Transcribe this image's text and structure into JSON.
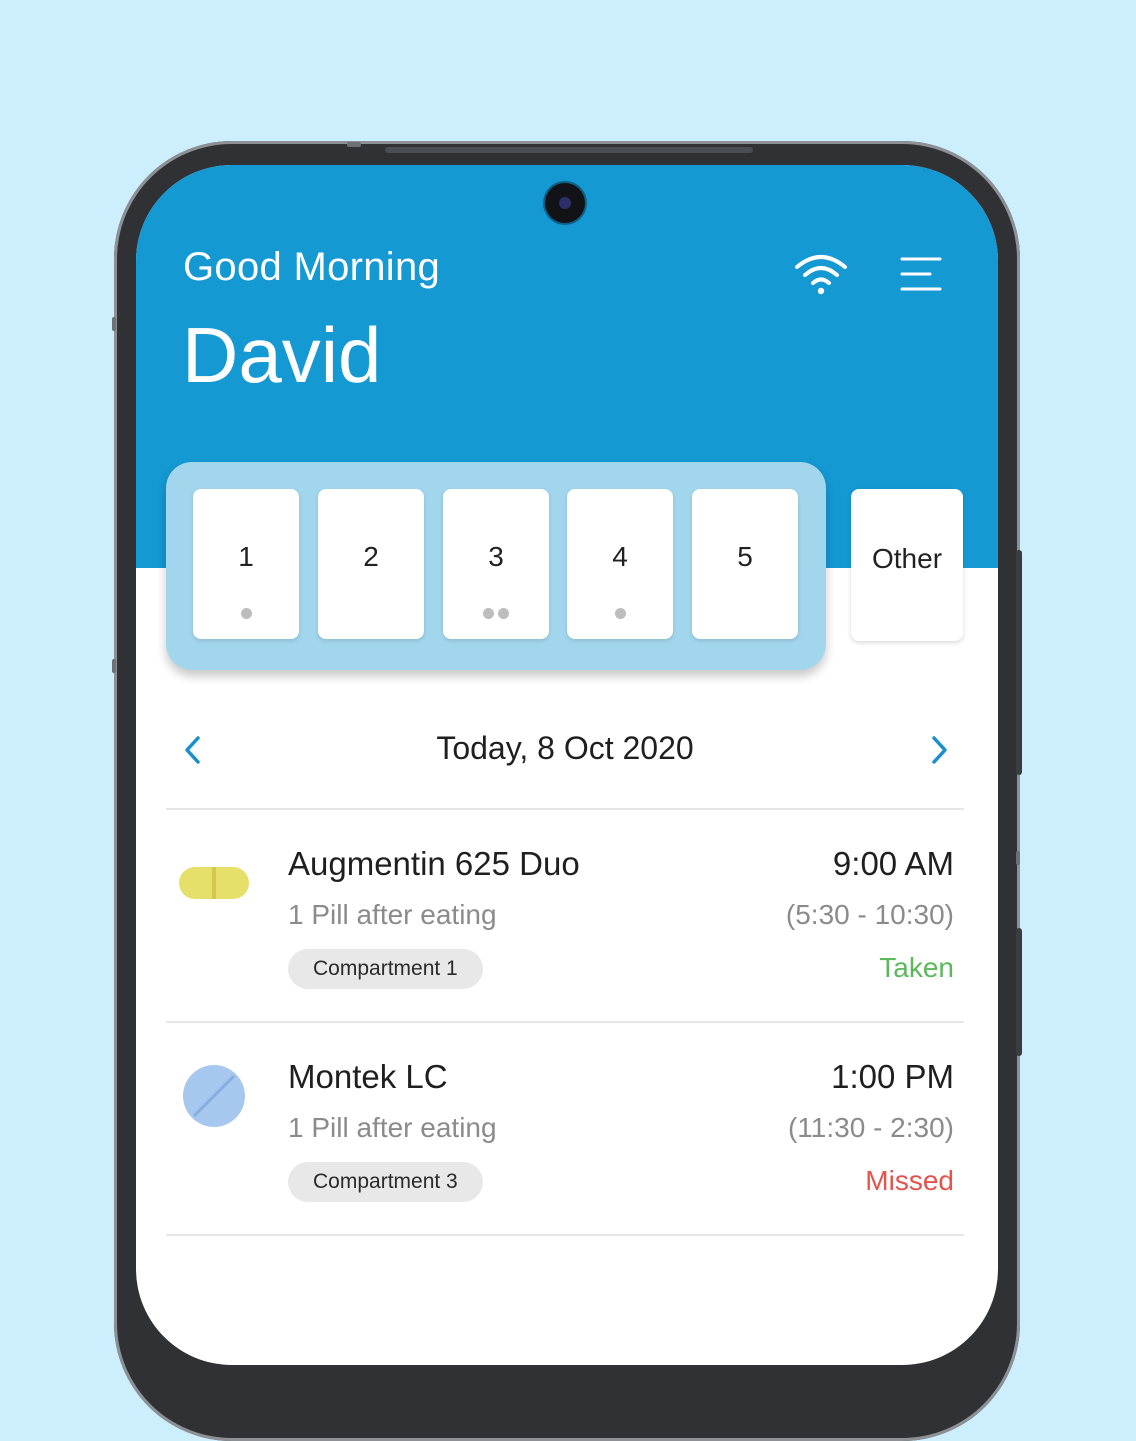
{
  "colors": {
    "background": "#cdeefc",
    "header": "#1499d3",
    "tray": "#a2d6ec",
    "accent_chevron": "#1a8fcd",
    "taken": "#5cb85c",
    "missed": "#e5534b",
    "pill_yellow": "#e6e06b",
    "pill_blue": "#a6c8ee"
  },
  "header": {
    "greeting": "Good Morning",
    "user_name": "David",
    "wifi_icon": "wifi-icon",
    "menu_icon": "menu-icon"
  },
  "compartments": [
    {
      "label": "1",
      "dots": 1
    },
    {
      "label": "2",
      "dots": 0
    },
    {
      "label": "3",
      "dots": 2
    },
    {
      "label": "4",
      "dots": 1
    },
    {
      "label": "5",
      "dots": 0
    }
  ],
  "other_compartment": {
    "label": "Other"
  },
  "date_nav": {
    "prev_icon": "chevron-left-icon",
    "label": "Today, 8 Oct 2020",
    "next_icon": "chevron-right-icon"
  },
  "medications": [
    {
      "name": "Augmentin 625 Duo",
      "dose": "1 Pill after eating",
      "compartment": "Compartment 1",
      "time": "9:00 AM",
      "window": "(5:30 - 10:30)",
      "status": "Taken",
      "status_color": "#5cb85c",
      "icon": "capsule-icon"
    },
    {
      "name": "Montek LC",
      "dose": "1 Pill after eating",
      "compartment": "Compartment 3",
      "time": "1:00 PM",
      "window": "(11:30 - 2:30)",
      "status": "Missed",
      "status_color": "#e5534b",
      "icon": "tablet-icon"
    }
  ]
}
